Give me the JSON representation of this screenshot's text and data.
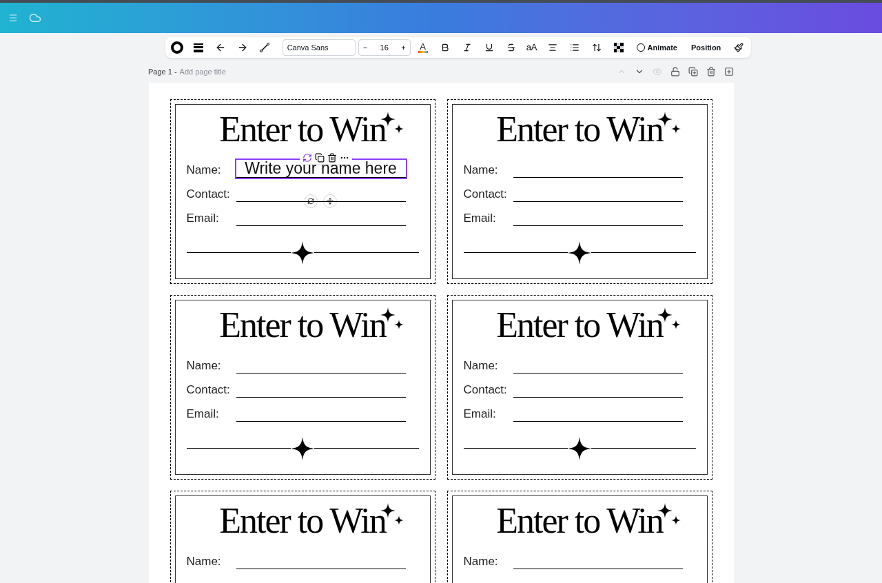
{
  "toolbar": {
    "font": "Canva Sans",
    "size": "16",
    "minus": "−",
    "plus": "+",
    "text_color_label": "A",
    "case_label": "aA",
    "animate": "Animate",
    "position": "Position"
  },
  "page_header": {
    "label": "Page 1 -",
    "title_placeholder": "Add page title"
  },
  "cards": [
    {
      "title": "Enter to Win",
      "fields": [
        {
          "label": "Name:",
          "value": "Write your name here",
          "selected": true
        },
        {
          "label": "Contact:",
          "selected": false
        },
        {
          "label": "Email:",
          "selected": false
        }
      ]
    },
    {
      "title": "Enter to Win",
      "fields": [
        {
          "label": "Name:",
          "selected": false
        },
        {
          "label": "Contact:",
          "selected": false
        },
        {
          "label": "Email:",
          "selected": false
        }
      ]
    },
    {
      "title": "Enter to Win",
      "fields": [
        {
          "label": "Name:",
          "selected": false
        },
        {
          "label": "Contact:",
          "selected": false
        },
        {
          "label": "Email:",
          "selected": false
        }
      ]
    },
    {
      "title": "Enter to Win",
      "fields": [
        {
          "label": "Name:",
          "selected": false
        },
        {
          "label": "Contact:",
          "selected": false
        },
        {
          "label": "Email:",
          "selected": false
        }
      ]
    },
    {
      "title": "Enter to Win",
      "fields": [
        {
          "label": "Name:",
          "selected": false
        }
      ]
    },
    {
      "title": "Enter to Win",
      "fields": [
        {
          "label": "Name:",
          "selected": false
        }
      ]
    }
  ]
}
